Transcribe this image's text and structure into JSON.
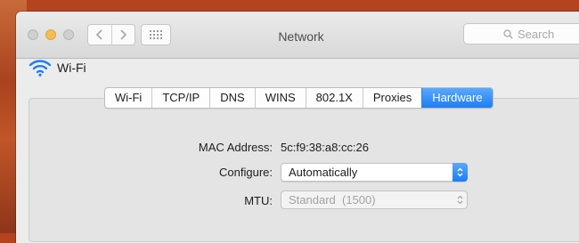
{
  "window": {
    "title": "Network"
  },
  "toolbar": {
    "back_icon": "chevron-left-icon",
    "forward_icon": "chevron-right-icon",
    "grid_icon": "grid-icon"
  },
  "search": {
    "placeholder": "Search"
  },
  "interface": {
    "name": "Wi-Fi"
  },
  "tabs": [
    {
      "label": "Wi-Fi"
    },
    {
      "label": "TCP/IP"
    },
    {
      "label": "DNS"
    },
    {
      "label": "WINS"
    },
    {
      "label": "802.1X"
    },
    {
      "label": "Proxies"
    },
    {
      "label": "Hardware",
      "active": true
    }
  ],
  "hardware": {
    "mac_label": "MAC Address:",
    "mac_value": "5c:f9:38:a8:cc:26",
    "configure_label": "Configure:",
    "configure_value": "Automatically",
    "mtu_label": "MTU:",
    "mtu_value": "Standard  (1500)"
  },
  "colors": {
    "accent": "#1c7ef1",
    "minimize": "#f5bf4f"
  }
}
